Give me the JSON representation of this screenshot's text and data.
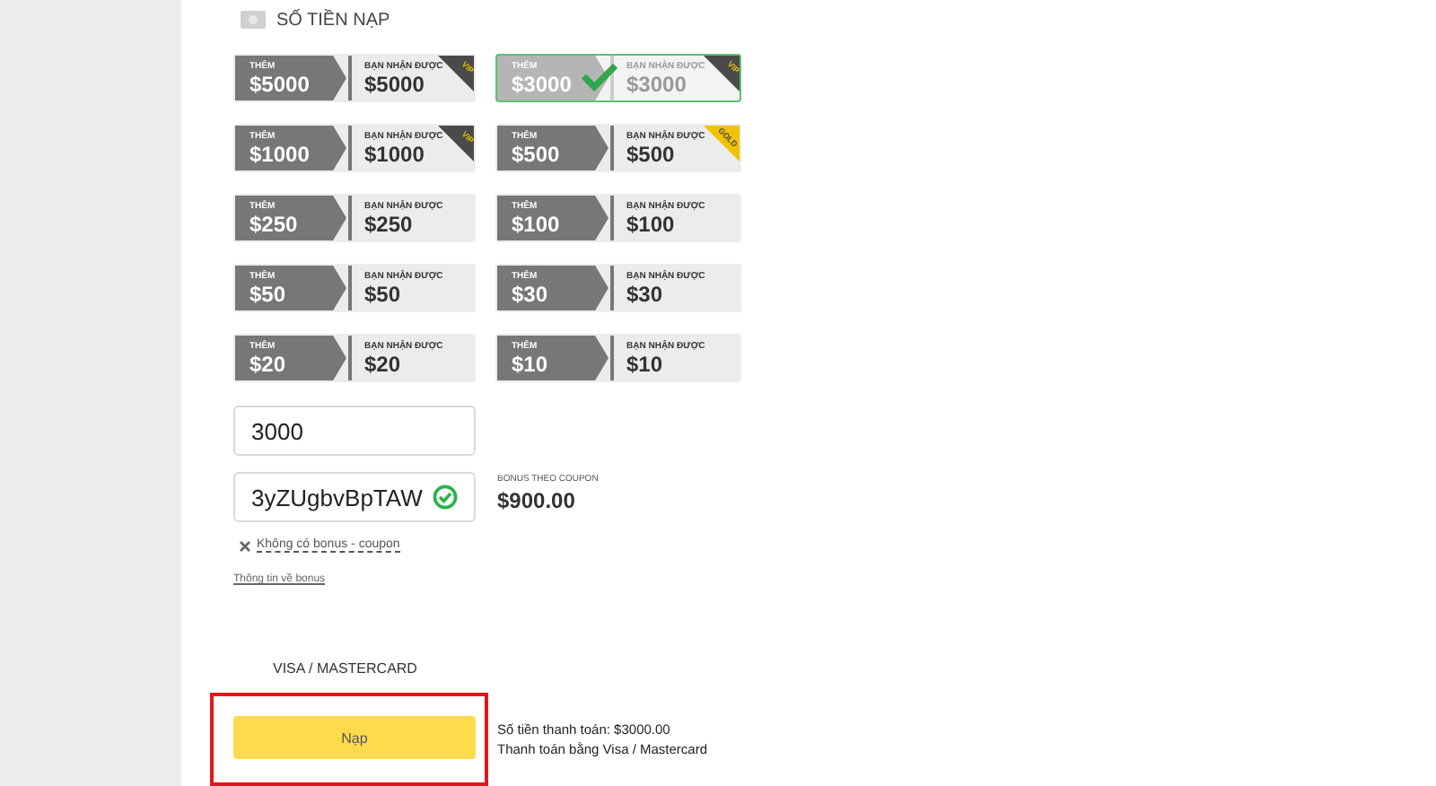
{
  "section": {
    "title": "SỐ TIỀN NẠP"
  },
  "amounts": [
    {
      "add_label": "THÊM",
      "add": "$5000",
      "get_label": "BẠN NHẬN ĐƯỢC",
      "get": "$5000",
      "badge": {
        "kind": "vip",
        "text": "VIP"
      },
      "selected": false
    },
    {
      "add_label": "THÊM",
      "add": "$3000",
      "get_label": "BẠN NHẬN ĐƯỢC",
      "get": "$3000",
      "badge": {
        "kind": "vip",
        "text": "VIP"
      },
      "selected": true
    },
    {
      "add_label": "THÊM",
      "add": "$1000",
      "get_label": "BẠN NHẬN ĐƯỢC",
      "get": "$1000",
      "badge": {
        "kind": "vip",
        "text": "VIP"
      },
      "selected": false
    },
    {
      "add_label": "THÊM",
      "add": "$500",
      "get_label": "BẠN NHẬN ĐƯỢC",
      "get": "$500",
      "badge": {
        "kind": "gold",
        "text": "GOLD"
      },
      "selected": false
    },
    {
      "add_label": "THÊM",
      "add": "$250",
      "get_label": "BẠN NHẬN ĐƯỢC",
      "get": "$250",
      "selected": false
    },
    {
      "add_label": "THÊM",
      "add": "$100",
      "get_label": "BẠN NHẬN ĐƯỢC",
      "get": "$100",
      "selected": false
    },
    {
      "add_label": "THÊM",
      "add": "$50",
      "get_label": "BẠN NHẬN ĐƯỢC",
      "get": "$50",
      "selected": false
    },
    {
      "add_label": "THÊM",
      "add": "$30",
      "get_label": "BẠN NHẬN ĐƯỢC",
      "get": "$30",
      "selected": false
    },
    {
      "add_label": "THÊM",
      "add": "$20",
      "get_label": "BẠN NHẬN ĐƯỢC",
      "get": "$20",
      "selected": false
    },
    {
      "add_label": "THÊM",
      "add": "$10",
      "get_label": "BẠN NHẬN ĐƯỢC",
      "get": "$10",
      "selected": false
    }
  ],
  "amount_field": {
    "value": "3000"
  },
  "coupon_field": {
    "value": "3yZUgbvBpTAW",
    "valid": true
  },
  "coupon_bonus": {
    "label": "BONUS THEO COUPON",
    "value": "$900.00"
  },
  "no_bonus_link": "Không có bonus - coupon",
  "bonus_info_link": "Thông tin về bonus",
  "payment_method": "VISA / MASTERCARD",
  "submit_button": {
    "label": "Nạp",
    "highlighted": true
  },
  "summary": [
    "Số tiền thanh toán: $3000.00",
    "Thanh toán bằng Visa / Mastercard"
  ]
}
